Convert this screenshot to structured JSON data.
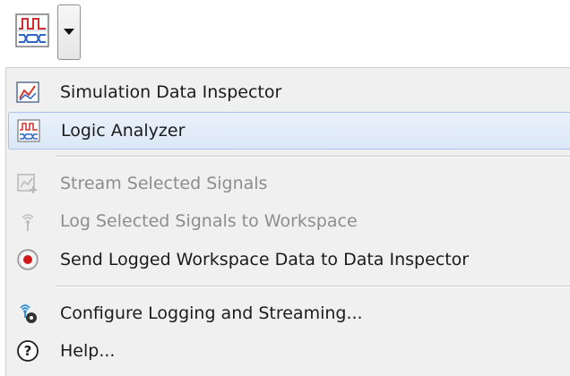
{
  "toolbar": {
    "main_button_icon": "logic-analyzer-icon",
    "dropdown_icon": "caret-down-icon"
  },
  "menu": {
    "items": [
      {
        "label": "Simulation Data Inspector",
        "icon": "data-inspector-icon",
        "enabled": true
      },
      {
        "label": "Logic Analyzer",
        "icon": "logic-analyzer-icon",
        "enabled": true,
        "highlighted": true
      },
      {
        "label": "Stream Selected Signals",
        "icon": "stream-signals-icon",
        "enabled": false
      },
      {
        "label": "Log Selected Signals to Workspace",
        "icon": "log-signals-icon",
        "enabled": false
      },
      {
        "label": "Send Logged Workspace Data to Data Inspector",
        "icon": "record-icon",
        "enabled": true
      },
      {
        "label": "Configure Logging and Streaming...",
        "icon": "configure-logging-icon",
        "enabled": true
      },
      {
        "label": "Help...",
        "icon": "help-icon",
        "enabled": true
      }
    ]
  },
  "colors": {
    "menu_background": "#f0f0f0",
    "highlight_border": "#a9c6ea",
    "record_red": "#d11818",
    "disabled_text": "#8d8d8d"
  }
}
